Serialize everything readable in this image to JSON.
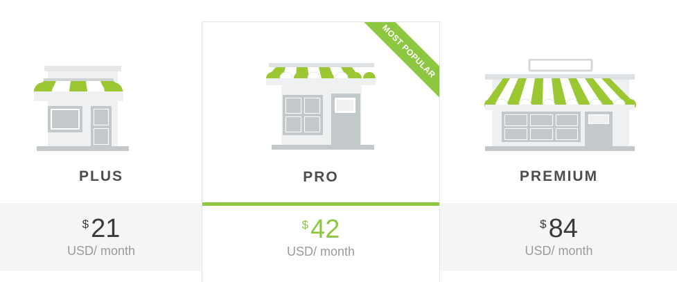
{
  "plans": [
    {
      "name": "PLUS",
      "currency": "$",
      "price": "21",
      "period": "USD/ month"
    },
    {
      "name": "PRO",
      "currency": "$",
      "price": "42",
      "period": "USD/ month",
      "badge": "MOST POPULAR"
    },
    {
      "name": "PREMIUM",
      "currency": "$",
      "price": "84",
      "period": "USD/ month"
    }
  ],
  "colors": {
    "accent": "#8dc63f",
    "store_grey": "#d3d6d8",
    "band": "#f5f5f5"
  },
  "icons": {
    "plus": "small-store-icon",
    "pro": "medium-store-icon",
    "premium": "large-store-icon"
  }
}
